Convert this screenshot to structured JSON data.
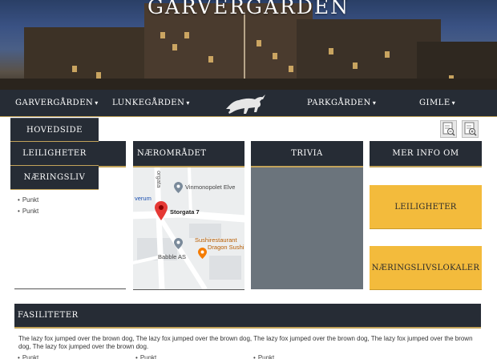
{
  "hero": {
    "title": "GARVERGÅRDEN"
  },
  "nav": {
    "items": [
      {
        "label": "GARVERGÅRDEN",
        "caret": "▾"
      },
      {
        "label": "LUNKEGÅRDEN",
        "caret": "▾"
      },
      {
        "label": "PARKGÅRDEN",
        "caret": "▾"
      },
      {
        "label": "GIMLE",
        "caret": "▾"
      }
    ],
    "logo_icon": "bull-logo"
  },
  "dropdown": {
    "items": [
      "HOVEDSIDE",
      "LEILIGHETER",
      "NÆRINGSLIV"
    ]
  },
  "toolbar": {
    "icons": [
      "zoom-out-document-icon",
      "zoom-in-document-icon"
    ]
  },
  "columns": {
    "narområdet": "NÆROMRÅDET",
    "trivia": "TRIVIA",
    "mer_info": "MER INFO OM"
  },
  "left_list": [
    "Punkt",
    "Punkt"
  ],
  "map": {
    "labels": {
      "storgata": "Storgata 7",
      "vinmonopolet": "Vinmonopolet Elve",
      "sushi1": "Sushirestaurant",
      "sushi2": "Dragon Sushi Elver",
      "babble": "Babble AS",
      "verum": "verum",
      "street": "orgata"
    }
  },
  "buttons": {
    "leiligheter": "LEILIGHETER",
    "naringslokaler": "NÆRINGSLIVSLOKALER"
  },
  "facilities": {
    "title": "FASILITETER",
    "text": "The lazy fox jumped over the brown dog, The lazy fox jumped over the brown dog, The lazy fox jumped over the brown dog, The lazy fox jumped over the brown dog, The lazy fox jumped over the brown dog.",
    "bullets": [
      "Punkt",
      "Punkt",
      "Punkt"
    ]
  },
  "colors": {
    "nav": "#262c35",
    "gold": "#c2a35a",
    "button": "#f3bb3c",
    "trivia": "#6b747c"
  }
}
